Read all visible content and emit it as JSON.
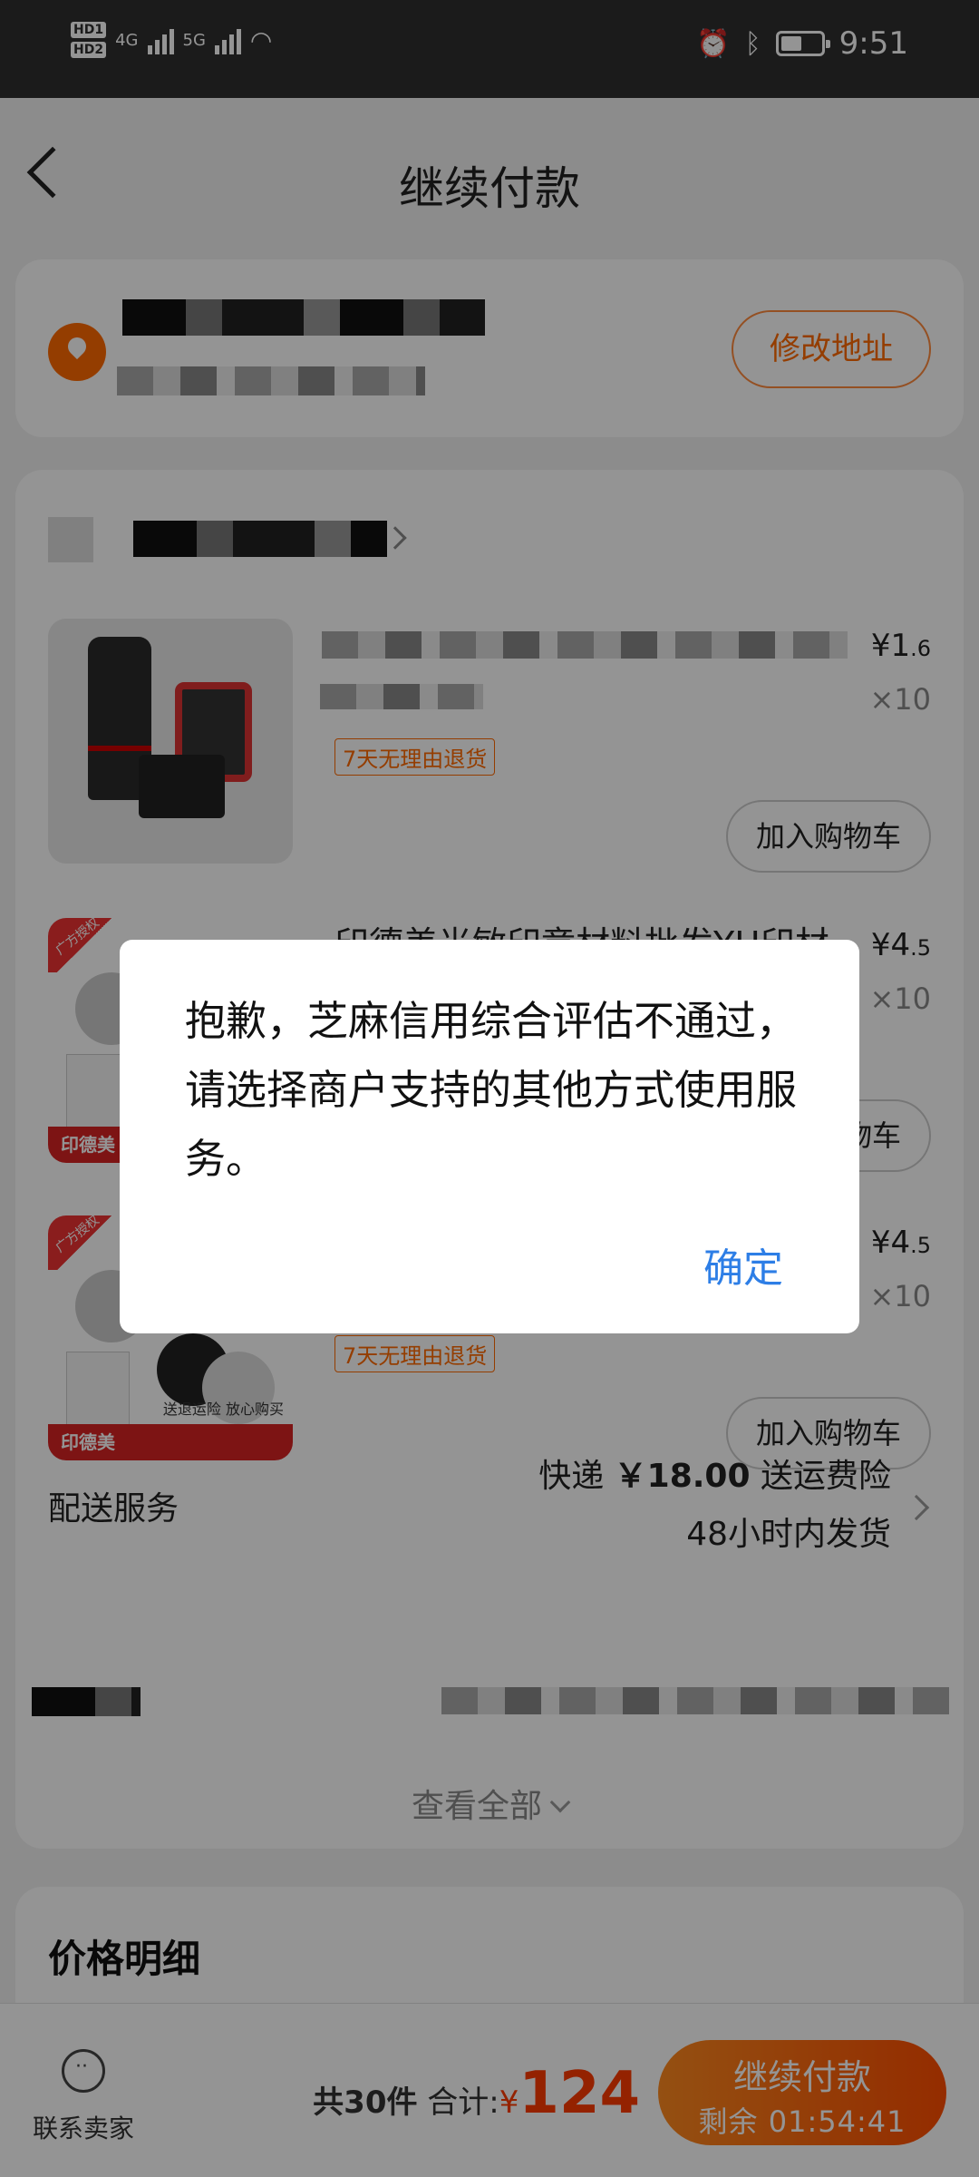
{
  "status_bar": {
    "hd1": "HD1",
    "hd2": "HD2",
    "net1": "4G",
    "net2": "5G",
    "time": "9:51"
  },
  "header": {
    "title": "继续付款"
  },
  "address": {
    "edit_label": "修改地址"
  },
  "items": [
    {
      "price_main": "¥1",
      "price_dec": ".6",
      "qty": "×10",
      "return_policy": "7天无理由退货",
      "cart_label": "加入购物车"
    },
    {
      "title": "印德美光敏印章材料批发YH印材",
      "price_main": "¥4",
      "price_dec": ".5",
      "qty": "×10",
      "cart_label": "加入购物车"
    },
    {
      "price_main": "¥4",
      "price_dec": ".5",
      "qty": "×10",
      "return_policy": "7天无理由退货",
      "cart_label": "加入购物车",
      "promo_slogan": "送退运险 放心购买"
    }
  ],
  "promo_tag": "广方授权",
  "promo_band": "印德美",
  "shipping": {
    "label": "配送服务",
    "method": "快递",
    "fee": "￥18.00",
    "insurance": "送运费险",
    "dispatch": "48小时内发货"
  },
  "view_all": "查看全部",
  "price_detail_title": "价格明细",
  "bottom_bar": {
    "contact_label": "联系卖家",
    "count_label": "共30件",
    "total_label": "合计:",
    "currency": "¥",
    "total_amount": "124",
    "pay_label": "继续付款",
    "countdown": "剩余 01:54:41"
  },
  "dialog": {
    "message": "抱歉，芝麻信用综合评估不通过，请选择商户支持的其他方式使用服务。",
    "ok_label": "确定"
  },
  "colors": {
    "accent": "#ff6a00",
    "link": "#2d7ee6"
  }
}
